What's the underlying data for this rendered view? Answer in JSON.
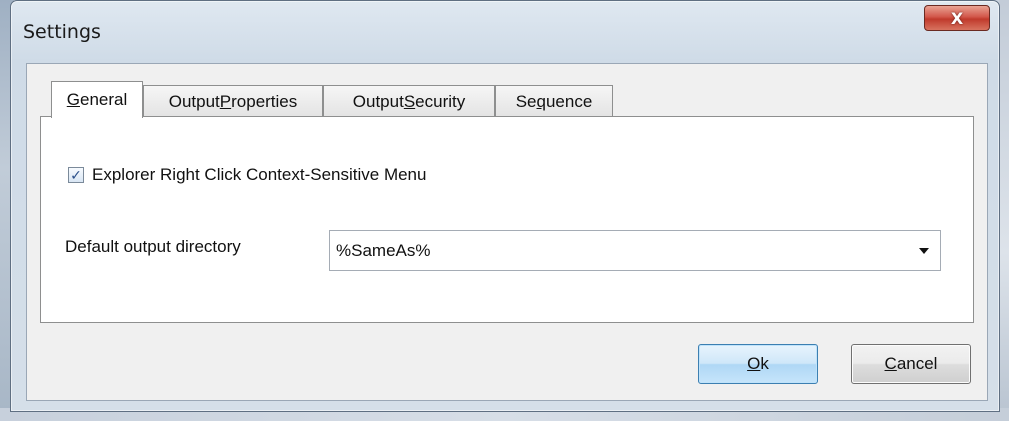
{
  "window": {
    "title": "Settings",
    "close_glyph": "X"
  },
  "tabs": [
    {
      "prefix": "",
      "accel": "G",
      "suffix": "eneral",
      "active": true
    },
    {
      "prefix": "Output ",
      "accel": "P",
      "suffix": "roperties",
      "active": false
    },
    {
      "prefix": "Output ",
      "accel": "S",
      "suffix": "ecurity",
      "active": false
    },
    {
      "prefix": "Se",
      "accel": "q",
      "suffix": "uence",
      "active": false
    }
  ],
  "general": {
    "context_menu_checkbox": {
      "label": "Explorer Right Click Context-Sensitive Menu",
      "checked": true,
      "check_glyph": "✓"
    },
    "output_directory": {
      "label": "Default output directory",
      "value": "%SameAs%"
    }
  },
  "buttons": {
    "ok": {
      "accel": "O",
      "suffix": "k"
    },
    "cancel": {
      "accel": "C",
      "suffix": "ancel"
    }
  },
  "icons": {
    "close": "close-icon",
    "check": "checkmark-icon",
    "dropdown": "chevron-down-icon"
  },
  "colors": {
    "close_button": "#c9483a",
    "ok_border": "#3c7fb1",
    "title_bar": "#dfe8f1"
  }
}
